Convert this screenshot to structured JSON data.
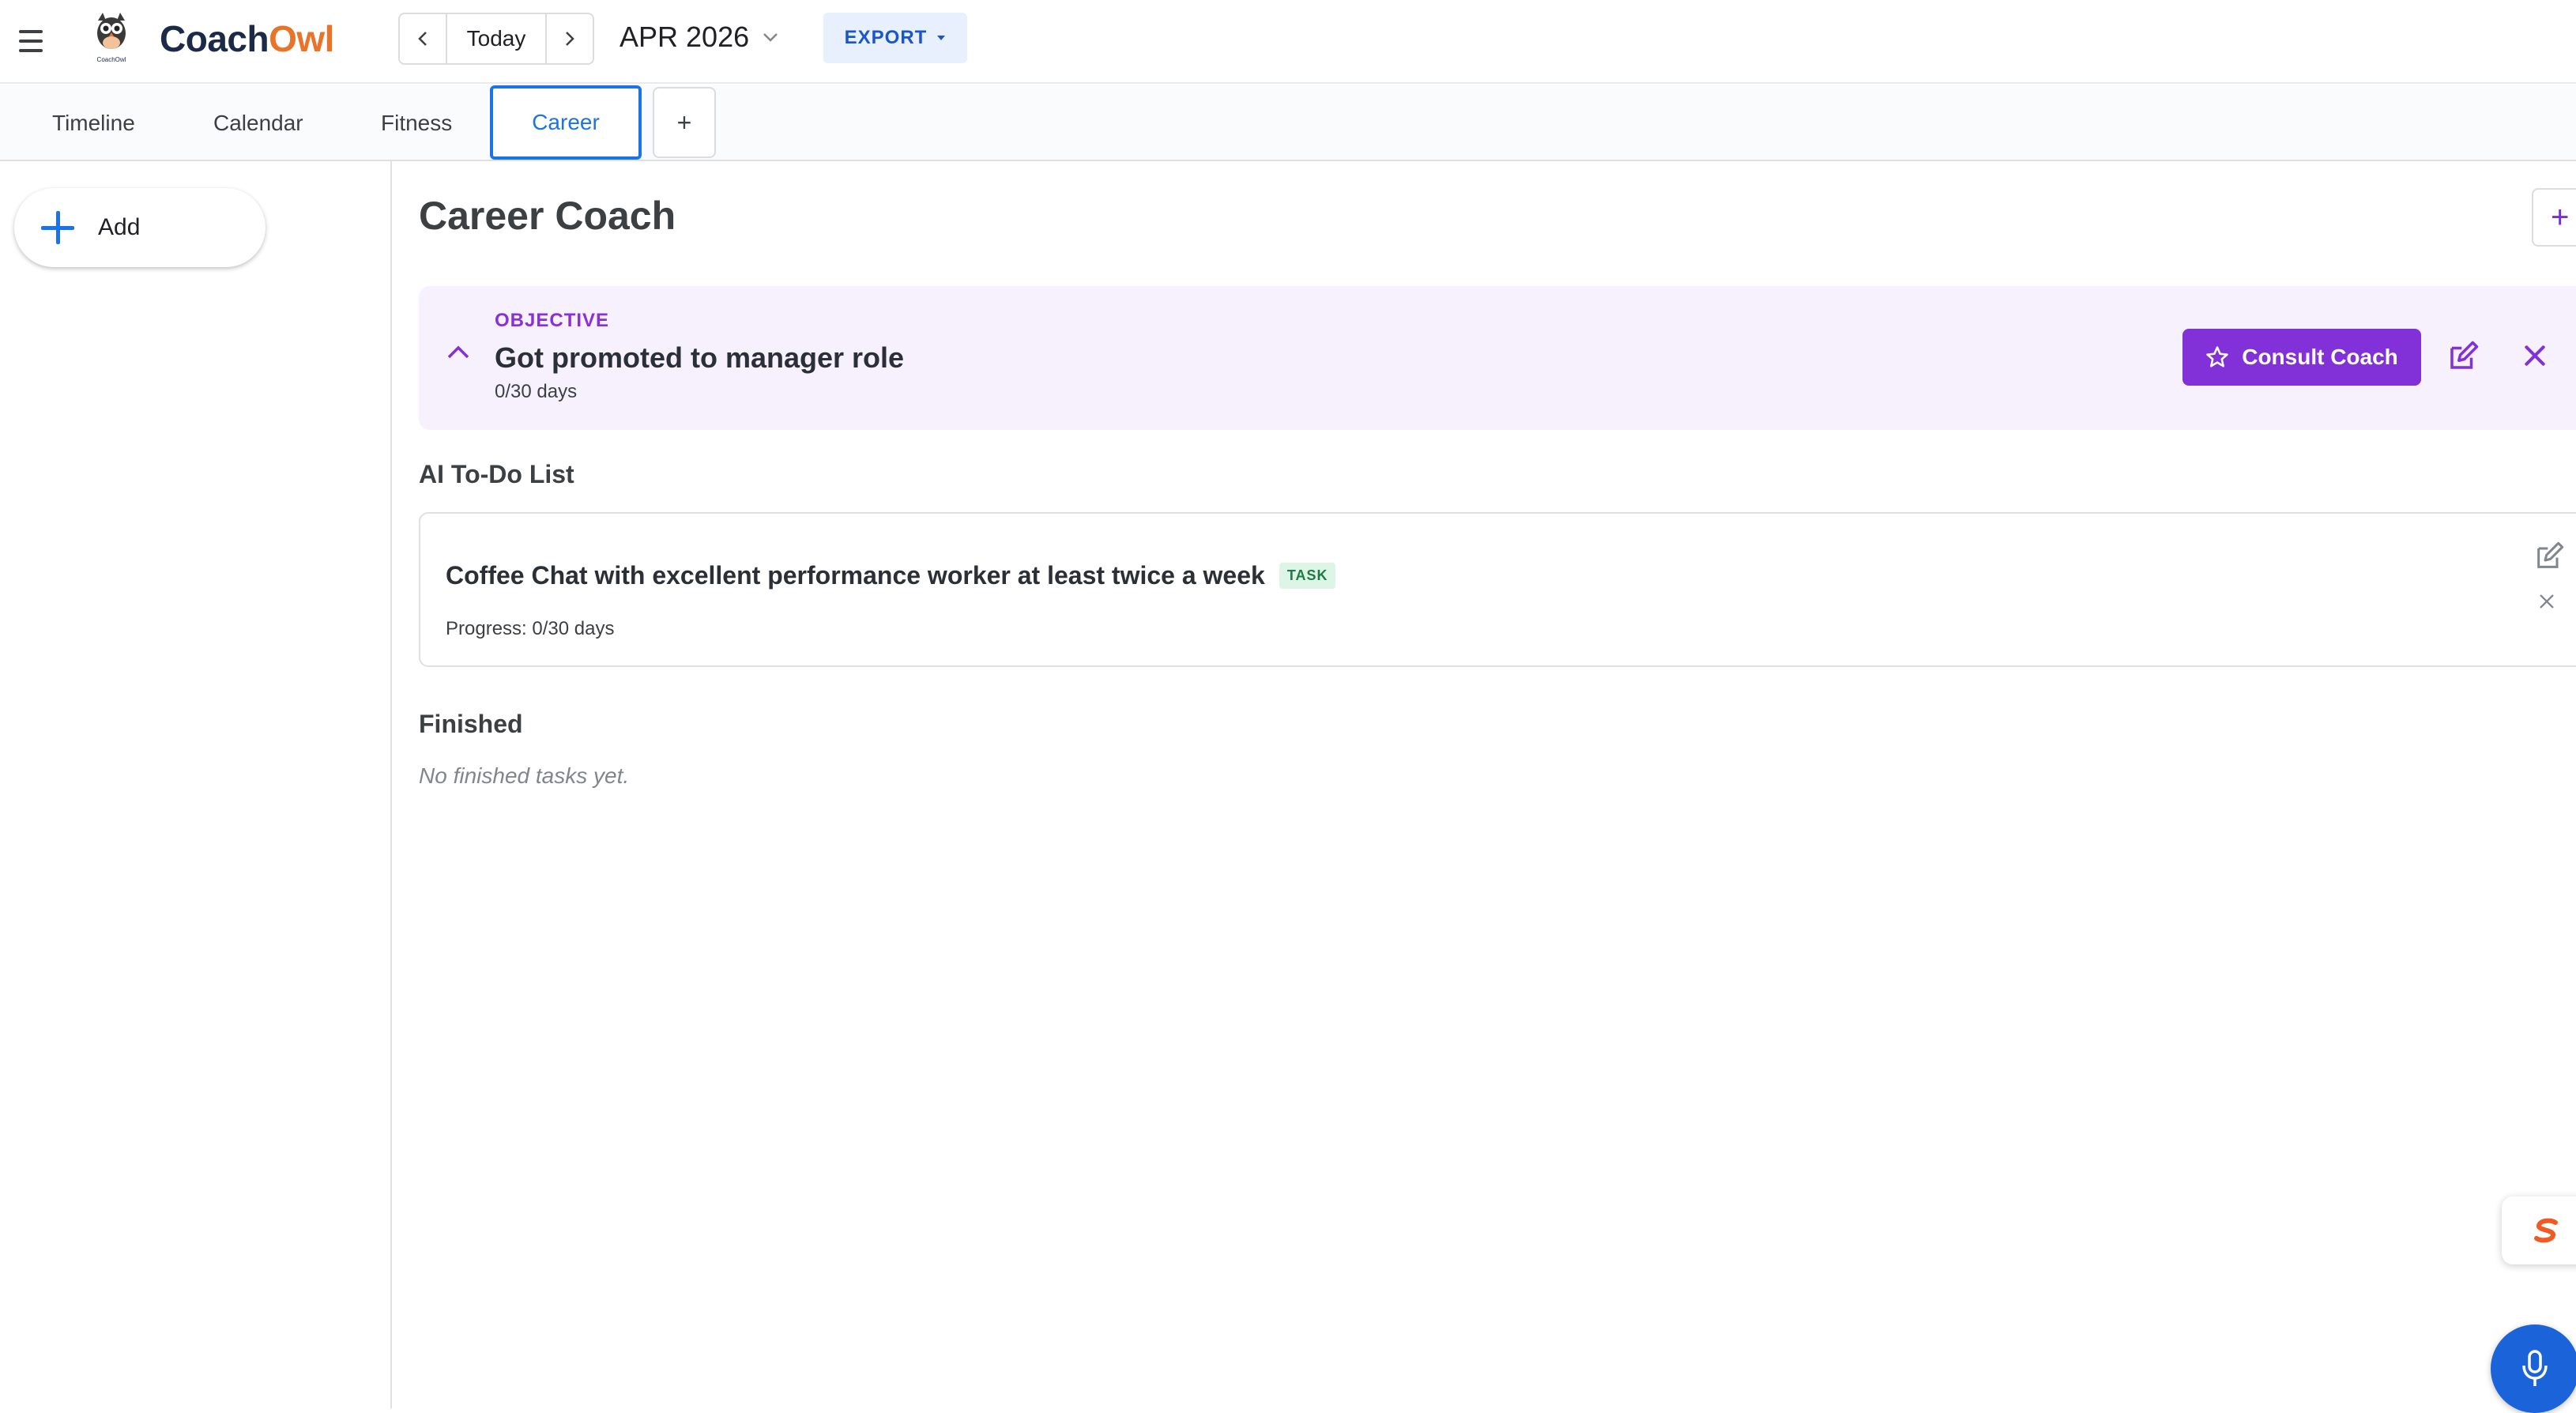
{
  "app": {
    "brand_part1": "Coach",
    "brand_part2": "Owl",
    "logo_caption": "CoachOwl",
    "accent_color": "#1a73e8",
    "brand_orange": "#e8742a",
    "purple": "#8230d8"
  },
  "toolbar": {
    "prev_icon": "chevron-left-icon",
    "today_label": "Today",
    "next_icon": "chevron-right-icon",
    "month_label": "APR 2026",
    "export_label": "EXPORT"
  },
  "tabs": [
    {
      "label": "Timeline",
      "active": false
    },
    {
      "label": "Calendar",
      "active": false
    },
    {
      "label": "Fitness",
      "active": false
    },
    {
      "label": "Career",
      "active": true
    }
  ],
  "tab_add_label": "+",
  "sidebar": {
    "add_label": "Add"
  },
  "main": {
    "title": "Career Coach",
    "corner_button": "+",
    "objective": {
      "tag": "OBJECTIVE",
      "title": "Got promoted to manager role",
      "progress": "0/30 days",
      "consult_label": "Consult Coach"
    },
    "todo_heading": "AI To-Do List",
    "tasks": [
      {
        "title": "Coffee Chat with excellent performance worker at least twice a week",
        "badge": "TASK",
        "progress": "Progress: 0/30 days"
      }
    ],
    "finished_heading": "Finished",
    "finished_empty": "No finished tasks yet."
  },
  "floating": {
    "s_widget_icon": "s-logo-icon",
    "mic_icon": "microphone-icon"
  }
}
